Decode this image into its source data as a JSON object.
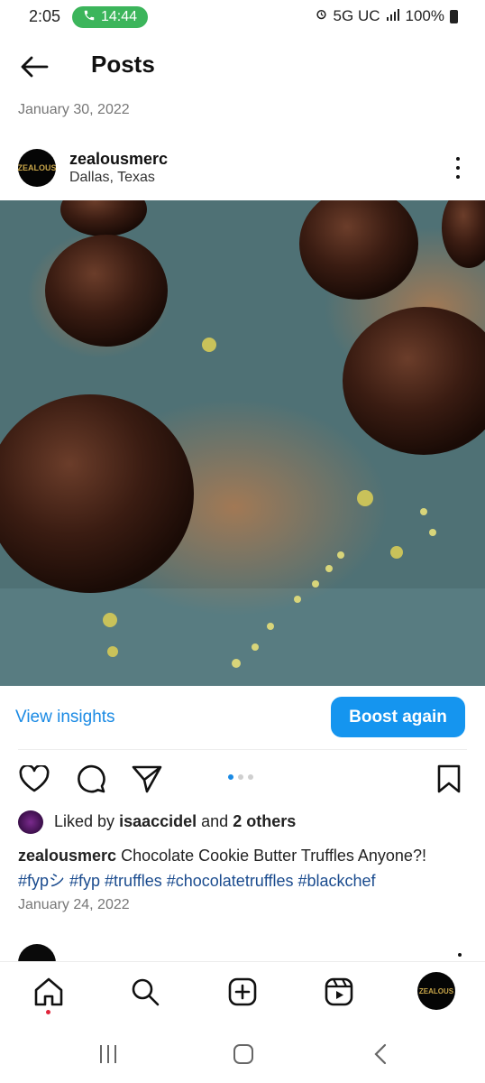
{
  "status_bar": {
    "time": "2:05",
    "call_time": "14:44",
    "network": "5G UC",
    "battery": "100%"
  },
  "header": {
    "title": "Posts",
    "back_icon": "arrow-left-icon"
  },
  "top_date": "January 30, 2022",
  "post": {
    "username": "zealousmerc",
    "location": "Dallas, Texas",
    "avatar_text": "ZEALOUS",
    "photo_description": "photo",
    "insights_label": "View insights",
    "boost_label": "Boost again",
    "liked_prefix": "Liked by",
    "liked_user": "isaaccidel",
    "liked_and": "and",
    "liked_others": "2 others",
    "caption_user": "zealousmerc",
    "caption_text": "Chocolate Cookie Butter Truffles Anyone?!",
    "hashtags": "#fypシ #fyp #truffles #chocolatetruffles #blackchef",
    "date": "January 24, 2022",
    "carousel_count": 3,
    "carousel_active": 1
  },
  "bottom_nav": {
    "items": [
      "home-icon",
      "search-icon",
      "create-icon",
      "reels-icon",
      "profile-avatar"
    ],
    "profile_text": "ZEALOUS"
  },
  "colors": {
    "accent": "#1595ef",
    "link": "#1a8ae4",
    "hashtag": "#1a4b8e",
    "call_green": "#3cb55b",
    "notification_red": "#e0243a"
  }
}
